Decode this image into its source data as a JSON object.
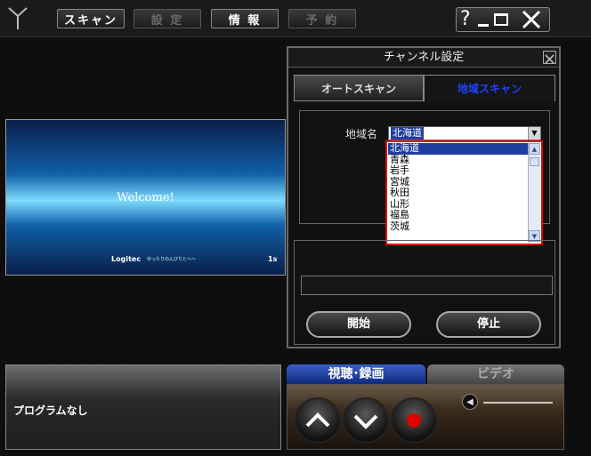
{
  "toolbar": {
    "scan_label": "スキャン",
    "settings_label": "設 定",
    "info_label": "情 報",
    "reserve_label": "予 約"
  },
  "window": {
    "help_label": "?"
  },
  "preview": {
    "welcome_text": "Welcome!",
    "brand_text": "Logitec",
    "tagline": "ゆったりのんびりとへ～",
    "channel_badge": "1s"
  },
  "panel": {
    "title": "チャンネル設定",
    "tabs": {
      "auto_scan": "オートスキャン",
      "region_scan": "地域スキャン"
    },
    "region_label": "地域名",
    "region_selected": "北海道",
    "region_options": [
      "北海道",
      "青森",
      "岩手",
      "宮城",
      "秋田",
      "山形",
      "福島",
      "茨城"
    ],
    "start_label": "開始",
    "stop_label": "停止"
  },
  "program": {
    "text": "プログラムなし"
  },
  "bottom_tabs": {
    "view_record": "視聴･録画",
    "video": "ビデオ"
  },
  "colors": {
    "accent_blue": "#1e3e9e",
    "highlight_red": "#e00000",
    "tab_active_text": "#1b43ff"
  }
}
